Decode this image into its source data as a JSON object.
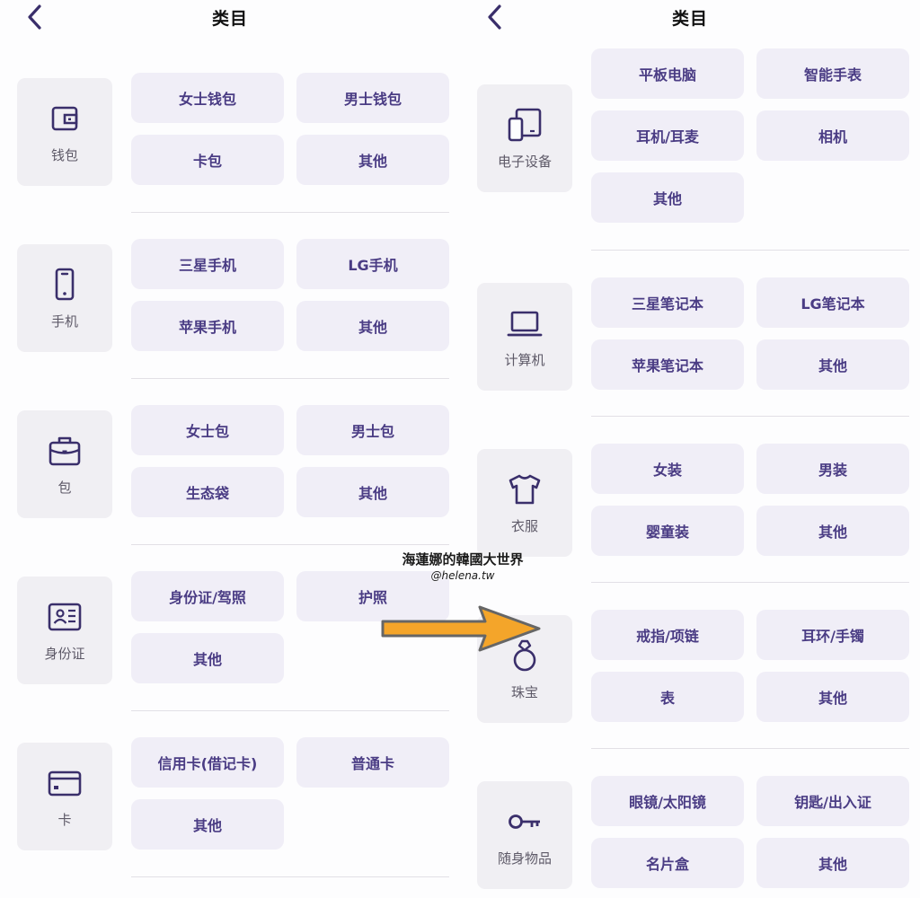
{
  "accent": "#4a3c84",
  "left": {
    "title": "类目",
    "categories": [
      {
        "label": "钱包",
        "icon": "wallet-icon",
        "items": [
          "女士钱包",
          "男士钱包",
          "卡包",
          "其他"
        ]
      },
      {
        "label": "手机",
        "icon": "phone-icon",
        "items": [
          "三星手机",
          "LG手机",
          "苹果手机",
          "其他"
        ]
      },
      {
        "label": "包",
        "icon": "bag-icon",
        "items": [
          "女士包",
          "男士包",
          "生态袋",
          "其他"
        ]
      },
      {
        "label": "身份证",
        "icon": "id-card-icon",
        "items": [
          "身份证/驾照",
          "护照",
          "其他"
        ]
      },
      {
        "label": "卡",
        "icon": "credit-card-icon",
        "items": [
          "信用卡(借记卡)",
          "普通卡",
          "其他"
        ]
      }
    ]
  },
  "right": {
    "title": "类目",
    "categories": [
      {
        "label": "电子设备",
        "icon": "tablet-icon",
        "items": [
          "平板电脑",
          "智能手表",
          "耳机/耳麦",
          "相机",
          "其他"
        ]
      },
      {
        "label": "计算机",
        "icon": "laptop-icon",
        "items": [
          "三星笔记本",
          "LG笔记本",
          "苹果笔记本",
          "其他"
        ]
      },
      {
        "label": "衣服",
        "icon": "shirt-icon",
        "items": [
          "女装",
          "男装",
          "婴童装",
          "其他"
        ]
      },
      {
        "label": "珠宝",
        "icon": "ring-icon",
        "items": [
          "戒指/项链",
          "耳环/手镯",
          "表",
          "其他"
        ]
      },
      {
        "label": "随身物品",
        "icon": "key-icon",
        "items": [
          "眼镜/太阳镜",
          "钥匙/出入证",
          "名片盒",
          "其他"
        ]
      }
    ]
  },
  "watermark": {
    "line1": "海蓮娜的韓國大世界",
    "line2": "@helena.tw"
  },
  "overlay": {
    "arrow_color": "#f4a52a"
  }
}
